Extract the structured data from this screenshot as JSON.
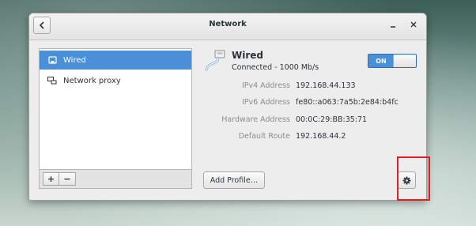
{
  "window": {
    "title": "Network"
  },
  "sidebar": {
    "items": [
      {
        "label": "Wired",
        "icon": "wired-network-icon",
        "selected": true
      },
      {
        "label": "Network proxy",
        "icon": "network-proxy-icon",
        "selected": false
      }
    ],
    "add_label": "+",
    "remove_label": "−"
  },
  "detail": {
    "title": "Wired",
    "status": "Connected - 1000 Mb/s",
    "switch_label": "ON",
    "properties": [
      {
        "label": "IPv4 Address",
        "value": "192.168.44.133"
      },
      {
        "label": "IPv6 Address",
        "value": "fe80::a063:7a5b:2e84:b4fc"
      },
      {
        "label": "Hardware Address",
        "value": "00:0C:29:BB:35:71"
      },
      {
        "label": "Default Route",
        "value": "192.168.44.2"
      }
    ],
    "add_profile_label": "Add Profile…"
  },
  "colors": {
    "accent": "#4a90d9",
    "highlight": "#e02020"
  }
}
